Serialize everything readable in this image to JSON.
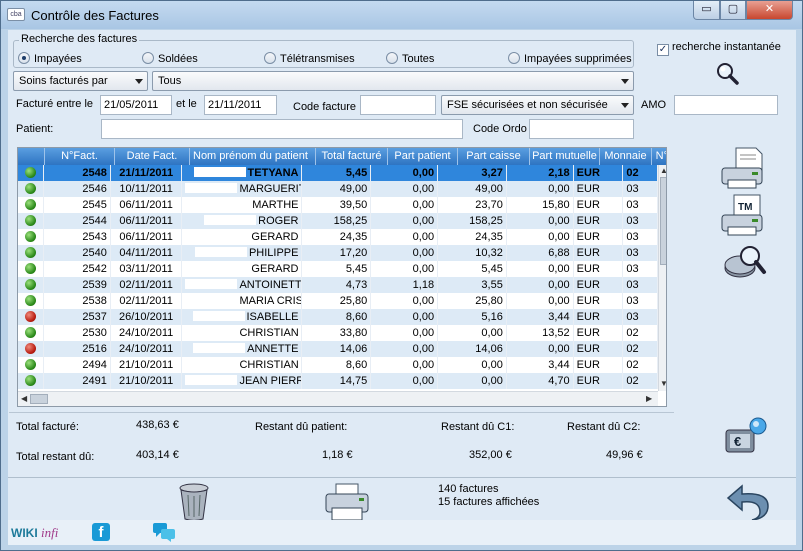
{
  "window": {
    "title": "Contrôle des Factures",
    "app_icon": "cba",
    "minimize": "▭",
    "maximize": "▢",
    "close": "✕"
  },
  "search": {
    "legend": "Recherche des factures",
    "radios": [
      {
        "label": "Impayées",
        "selected": true
      },
      {
        "label": "Soldées",
        "selected": false
      },
      {
        "label": "Télétransmises",
        "selected": false
      },
      {
        "label": "Toutes",
        "selected": false
      },
      {
        "label": "Impayées supprimées",
        "selected": false
      }
    ],
    "instant_label": "recherche instantanée",
    "instant_checked": "✓"
  },
  "filters": {
    "type_combo": "Soins facturés par",
    "value_combo": "Tous",
    "date_label": "Facturé entre le",
    "date_from": "21/05/2011",
    "date_and": "et le",
    "date_to": "21/11/2011",
    "code_label": "Code facture",
    "code_value": "",
    "fse_combo": "FSE sécurisées et non sécurisée",
    "amo_label": "AMO",
    "amo_value": "",
    "patient_label": "Patient:",
    "patient_value": "",
    "ordo_label": "Code Ordo",
    "ordo_value": ""
  },
  "grid": {
    "columns": [
      "",
      "N°Fact.",
      "Date Fact.",
      "Nom prénom du patient",
      "Total facturé",
      "Part patient",
      "Part caisse",
      "Part mutuelle",
      "Monnaie",
      "N°Inf."
    ],
    "rows": [
      {
        "status": "green",
        "num": "2548",
        "date": "21/11/2011",
        "name": "TETYANA",
        "total": "5,45",
        "patient": "0,00",
        "caisse": "3,27",
        "mutuelle": "2,18",
        "monnaie": "EUR",
        "inf": "02",
        "selected": true
      },
      {
        "status": "green",
        "num": "2546",
        "date": "10/11/2011",
        "name": "MARGUERITE",
        "total": "49,00",
        "patient": "0,00",
        "caisse": "49,00",
        "mutuelle": "0,00",
        "monnaie": "EUR",
        "inf": "03"
      },
      {
        "status": "green",
        "num": "2545",
        "date": "06/11/2011",
        "name": "MARTHE",
        "total": "39,50",
        "patient": "0,00",
        "caisse": "23,70",
        "mutuelle": "15,80",
        "monnaie": "EUR",
        "inf": "03"
      },
      {
        "status": "green",
        "num": "2544",
        "date": "06/11/2011",
        "name": "ROGER",
        "total": "158,25",
        "patient": "0,00",
        "caisse": "158,25",
        "mutuelle": "0,00",
        "monnaie": "EUR",
        "inf": "03"
      },
      {
        "status": "green",
        "num": "2543",
        "date": "06/11/2011",
        "name": "GERARD",
        "total": "24,35",
        "patient": "0,00",
        "caisse": "24,35",
        "mutuelle": "0,00",
        "monnaie": "EUR",
        "inf": "03"
      },
      {
        "status": "green",
        "num": "2540",
        "date": "04/11/2011",
        "name": "PHILIPPE",
        "total": "17,20",
        "patient": "0,00",
        "caisse": "10,32",
        "mutuelle": "6,88",
        "monnaie": "EUR",
        "inf": "03"
      },
      {
        "status": "green",
        "num": "2542",
        "date": "03/11/2011",
        "name": "GERARD",
        "total": "5,45",
        "patient": "0,00",
        "caisse": "5,45",
        "mutuelle": "0,00",
        "monnaie": "EUR",
        "inf": "03"
      },
      {
        "status": "green",
        "num": "2539",
        "date": "02/11/2011",
        "name": "ANTOINETTE",
        "total": "4,73",
        "patient": "1,18",
        "caisse": "3,55",
        "mutuelle": "0,00",
        "monnaie": "EUR",
        "inf": "03"
      },
      {
        "status": "green",
        "num": "2538",
        "date": "02/11/2011",
        "name": "MARIA CRISTINA",
        "total": "25,80",
        "patient": "0,00",
        "caisse": "25,80",
        "mutuelle": "0,00",
        "monnaie": "EUR",
        "inf": "03"
      },
      {
        "status": "red",
        "num": "2537",
        "date": "26/10/2011",
        "name": "ISABELLE",
        "total": "8,60",
        "patient": "0,00",
        "caisse": "5,16",
        "mutuelle": "3,44",
        "monnaie": "EUR",
        "inf": "03"
      },
      {
        "status": "green",
        "num": "2530",
        "date": "24/10/2011",
        "name": "CHRISTIAN",
        "total": "33,80",
        "patient": "0,00",
        "caisse": "0,00",
        "mutuelle": "13,52",
        "monnaie": "EUR",
        "inf": "02"
      },
      {
        "status": "red",
        "num": "2516",
        "date": "24/10/2011",
        "name": "ANNETTE",
        "total": "14,06",
        "patient": "0,00",
        "caisse": "14,06",
        "mutuelle": "0,00",
        "monnaie": "EUR",
        "inf": "02"
      },
      {
        "status": "green",
        "num": "2494",
        "date": "21/10/2011",
        "name": "CHRISTIAN",
        "total": "8,60",
        "patient": "0,00",
        "caisse": "0,00",
        "mutuelle": "3,44",
        "monnaie": "EUR",
        "inf": "02"
      },
      {
        "status": "green",
        "num": "2491",
        "date": "21/10/2011",
        "name": "JEAN PIERRE",
        "total": "14,75",
        "patient": "0,00",
        "caisse": "0,00",
        "mutuelle": "4,70",
        "monnaie": "EUR",
        "inf": "02"
      }
    ]
  },
  "totals": {
    "total_facture_label": "Total facturé:",
    "total_facture": "438,63 €",
    "restant_patient_label": "Restant dû patient:",
    "restant_c1_label": "Restant dû C1:",
    "restant_c2_label": "Restant dû C2:",
    "total_restant_label": "Total restant dû:",
    "total_restant": "403,14 €",
    "restant_patient": "1,18 €",
    "restant_c1": "352,00 €",
    "restant_c2": "49,96 €"
  },
  "status": {
    "factures": "140 factures",
    "affichees": "15 factures affichées"
  },
  "footer": {
    "wiki": "WIKI",
    "infi": "infi",
    "facebook": "f"
  },
  "colors": {
    "header_blue": "#3a82cf",
    "selected_row": "#2f86dc",
    "alt_row": "#ddeaf6",
    "window_bg": "#dfeaf5"
  }
}
